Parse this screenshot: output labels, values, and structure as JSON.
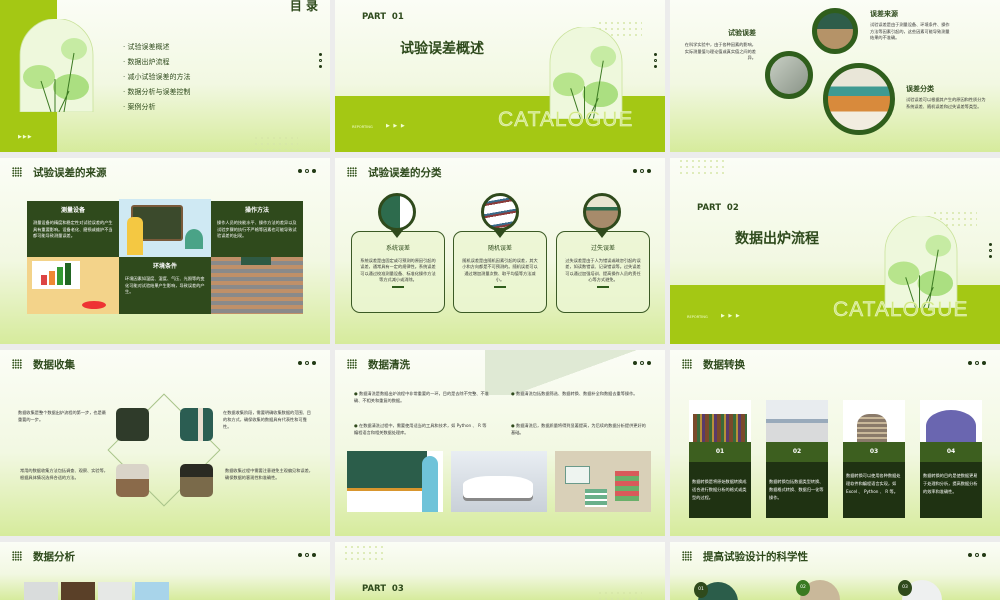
{
  "toc": {
    "title": "目 录",
    "items": [
      "试验误差概述",
      "数据出炉流程",
      "减小试验误差的方法",
      "数据分析与误差控制",
      "案例分析"
    ],
    "arrows": "▶▶▶"
  },
  "part01": {
    "part": "PART  01",
    "title": "试验误差概述",
    "reporting": "REPORTING",
    "arrows": "▶ ▶ ▶",
    "watermark": "CATALOGUE"
  },
  "overview": {
    "a": {
      "title": "试验误差",
      "text": "在科学实验中，由于各种因素的影响，实际测量值与理论值或真实值之间的差异。"
    },
    "b": {
      "title": "误差来源",
      "text": "试验误差是由于测量设备、环境条件、操作方法等因素引起的，这些因素可能导致测量结果的不准确。"
    },
    "c": {
      "title": "误差分类",
      "text": "试验误差可以根据其产生的原因和性质分为系统误差、随机误差和过失误差等类型。"
    }
  },
  "sources": {
    "title": "试验误差的来源",
    "cells": [
      {
        "title": "测量设备",
        "text": "测量设备的精度和稳定性对试验误差的产生具有重要影响。设备老化、磨损或维护不当都可能导致测量误差。"
      },
      {
        "title": "操作方法",
        "text": "操作人员的技能水平、操作方法的差异以及试验步骤的执行不严格等因素也可能导致试验误差的出现。"
      },
      {
        "title": "环境条件",
        "text": "环境因素如温度、湿度、气压、光照等的变化可能对试验结果产生影响，导致误差的产生。"
      }
    ]
  },
  "classification": {
    "title": "试验误差的分类",
    "cards": [
      {
        "title": "系统误差",
        "text": "系统误差是由固定或可预测的原因引起的误差，通常具有一定的规律性。系统误差可以通过校准测量设备、标准化操作方法等方式减小或消除。"
      },
      {
        "title": "随机误差",
        "text": "随机误差是由随机因素引起的误差，其大小和方向都是不可预测的。随机误差可以通过增加测量次数、取平均值等方法减小。"
      },
      {
        "title": "过失误差",
        "text": "过失误差是由于人为错误或疏忽引起的误差，如读数错误、记录错误等。过失误差可以通过加强培训、提高操作人员的责任心等方式避免。"
      }
    ]
  },
  "part02": {
    "part": "PART  02",
    "title": "数据出炉流程",
    "reporting": "REPORTING",
    "arrows": "▶ ▶ ▶",
    "watermark": "CATALOGUE"
  },
  "collect": {
    "title": "数据收集",
    "texts": [
      "数据收集是整个数据出炉流程的第一步，也是最重要的一步。",
      "在数据收集阶段，需要明确收集数据的范围、目的和方式，确保收集的数据具有代表性和可靠性。",
      "常用的数据收集方法包括调查、观察、实验等，根据具体情况选择合适的方法。",
      "数据收集过程中需要注意避免主观偏见和误差，确保数据的客观性和准确性。"
    ]
  },
  "clean": {
    "title": "数据清洗",
    "bullets": [
      "数据清洗是数据出炉流程中非常重要的一环，目的是去除不完整、不准确、不相关和重复的数据。",
      "在数据清洗过程中，需要使用适当的工具和技术，如 Python 、 R 等编程语言和相关数据处理库。",
      "数据清洗包括数据筛选、数据转换、数据补全和数据去重等操作。",
      "数据清洗后，数据质量将得到显著提高，为后续的数据分析提供更好的基础。"
    ]
  },
  "transform": {
    "title": "数据转换",
    "cols": [
      {
        "num": "01",
        "text": "数据转换是将原始数据转换成适合进行数据分析的格式或类型的过程。"
      },
      {
        "num": "02",
        "text": "数据转换包括数据类型转换、数据格式转换、数据归一化等操作。"
      },
      {
        "num": "03",
        "text": "数据转换可以使用各种数据处理软件和编程语言实现，如 Excel 、 Python 、 R 等。"
      },
      {
        "num": "04",
        "text": "数据转换的目的是使数据更易于处理和分析，提高数据分析的效率和准确性。"
      }
    ]
  },
  "analysis": {
    "title": "数据分析"
  },
  "part03": {
    "part": "PART  03"
  },
  "design": {
    "title": "提高试验设计的科学性",
    "nums": [
      "01",
      "02",
      "03"
    ]
  },
  "colors": {
    "accent": "#a4c814",
    "dark_green": "#2f4a1c",
    "bg": "#ececec"
  }
}
